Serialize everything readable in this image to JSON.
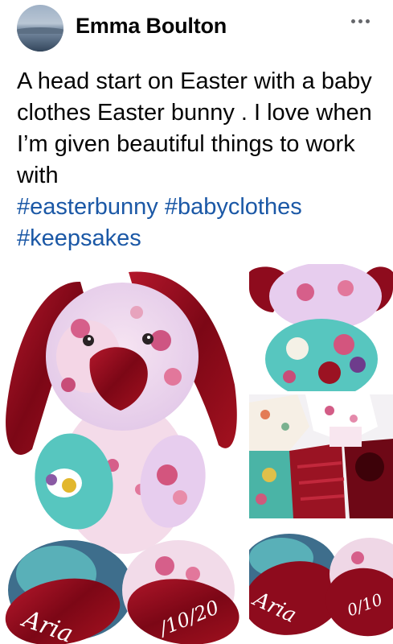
{
  "author": {
    "name": "Emma Boulton",
    "avatar_icon": "avatar-landscape"
  },
  "header": {
    "more_icon": "more-horizontal-icon"
  },
  "post": {
    "text": "A head start on Easter with a baby clothes Easter bunny . I love when I’m given beautiful things to work with",
    "hashtags": [
      "#easterbunny",
      "#babyclothes",
      "#keepsakes"
    ]
  },
  "photos": {
    "main": {
      "foot_left_text": "Aria",
      "foot_right_text": "/10/20"
    },
    "thumb_3": {
      "foot_left_text": "Aria",
      "foot_right_text": "0/10"
    }
  },
  "colors": {
    "hashtag": "#1b58a6",
    "velvet": "#8e0b1d",
    "lilac": "#e4cff0",
    "teal": "#56c6c0"
  }
}
